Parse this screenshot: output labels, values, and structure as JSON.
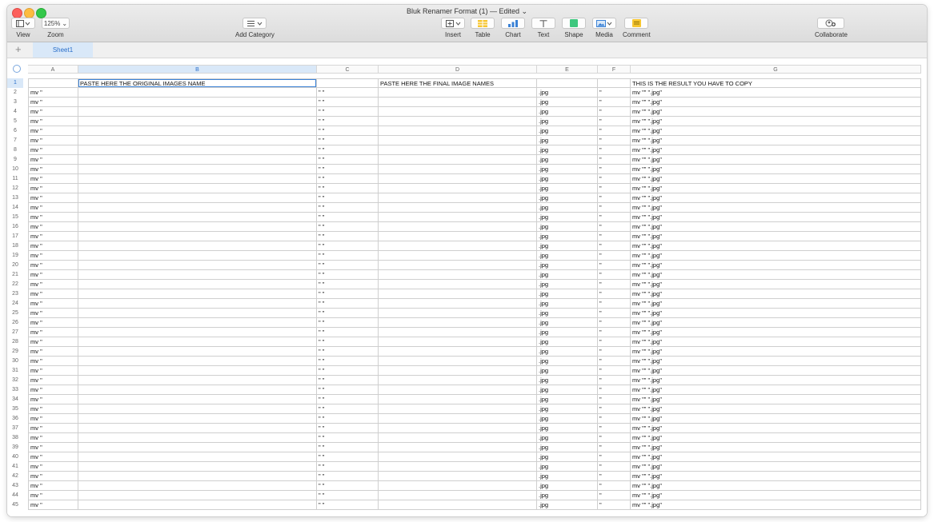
{
  "window": {
    "title": "Bluk Renamer Format (1) — Edited",
    "title_chevron": "⌄"
  },
  "toolbar": {
    "view_label": "View",
    "zoom_value": "125%",
    "zoom_label": "Zoom",
    "add_category_label": "Add Category",
    "insert_label": "Insert",
    "table_label": "Table",
    "chart_label": "Chart",
    "text_label": "Text",
    "shape_label": "Shape",
    "media_label": "Media",
    "comment_label": "Comment",
    "collaborate_label": "Collaborate",
    "icons": [
      "view-icon",
      "list-icon",
      "insert-icon",
      "table-icon",
      "chart-icon",
      "text-icon",
      "shape-icon",
      "media-icon",
      "comment-icon",
      "collaborate-icon"
    ]
  },
  "sheets": {
    "add": "+",
    "tabs": [
      "Sheet1"
    ]
  },
  "columns": [
    "A",
    "B",
    "C",
    "D",
    "E",
    "F",
    "G"
  ],
  "selected_column": "B",
  "header_row": {
    "number": "1",
    "cells": [
      "",
      "PASTE HERE THE ORIGINAL IMAGES NAME",
      "",
      "PASTE HERE THE FINAL IMAGE NAMES",
      "",
      "",
      "THIS IS THE RESULT YOU HAVE TO COPY"
    ]
  },
  "data_template": [
    "mv \"",
    "",
    "\" \"",
    "",
    ".jpg",
    "\"",
    "mv \"\" \".jpg\""
  ],
  "data_row_numbers": [
    "2",
    "3",
    "4",
    "5",
    "6",
    "7",
    "8",
    "9",
    "10",
    "11",
    "12",
    "13",
    "14",
    "15",
    "16",
    "17",
    "18",
    "19",
    "20",
    "21",
    "22",
    "23",
    "24",
    "25",
    "26",
    "27",
    "28",
    "29",
    "30",
    "31",
    "32",
    "33",
    "34",
    "35",
    "36",
    "37",
    "38",
    "39",
    "40",
    "41",
    "42",
    "43",
    "44",
    "45"
  ],
  "colors": {
    "accent": "#3b82d6",
    "selected_fill": "#d9e8f8"
  }
}
